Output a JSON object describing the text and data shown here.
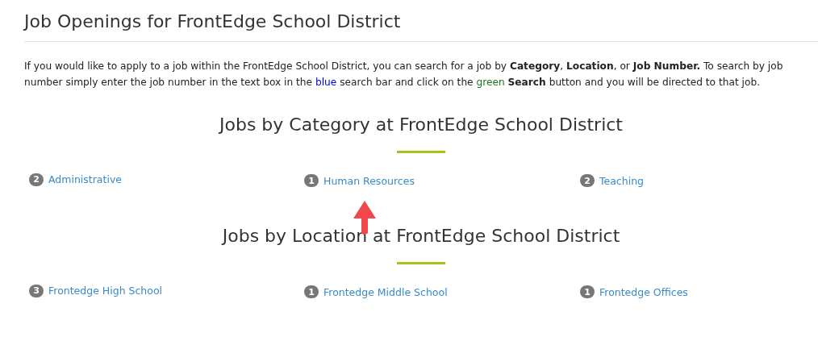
{
  "page_title": "Job Openings for FrontEdge School District",
  "intro": [
    {
      "text": "If you would like to apply to a job within the FrontEdge School District, you can search for a job by ",
      "kind": "plain"
    },
    {
      "text": "Category",
      "kind": "bold"
    },
    {
      "text": ", ",
      "kind": "plain"
    },
    {
      "text": "Location",
      "kind": "bold"
    },
    {
      "text": ", or ",
      "kind": "plain"
    },
    {
      "text": "Job Number.",
      "kind": "bold"
    },
    {
      "text": " To search by job number simply enter the job number in the text box in the ",
      "kind": "plain"
    },
    {
      "text": "blue",
      "kind": "blue"
    },
    {
      "text": " search bar and click on the ",
      "kind": "plain"
    },
    {
      "text": "green",
      "kind": "green"
    },
    {
      "text": "Search",
      "kind": "bold"
    },
    {
      "text": " button and you will be directed to that job.",
      "kind": "plain"
    }
  ],
  "sections": [
    {
      "heading": "Jobs by Category at FrontEdge School District",
      "items": [
        {
          "count": "2",
          "label": "Administrative"
        },
        {
          "count": "1",
          "label": "Human Resources"
        },
        {
          "count": "2",
          "label": "Teaching"
        }
      ]
    },
    {
      "heading": "Jobs by Location at FrontEdge School District",
      "items": [
        {
          "count": "3",
          "label": "Frontedge High School"
        },
        {
          "count": "1",
          "label": "Frontedge Middle School"
        },
        {
          "count": "1",
          "label": "Frontedge Offices"
        }
      ]
    }
  ]
}
